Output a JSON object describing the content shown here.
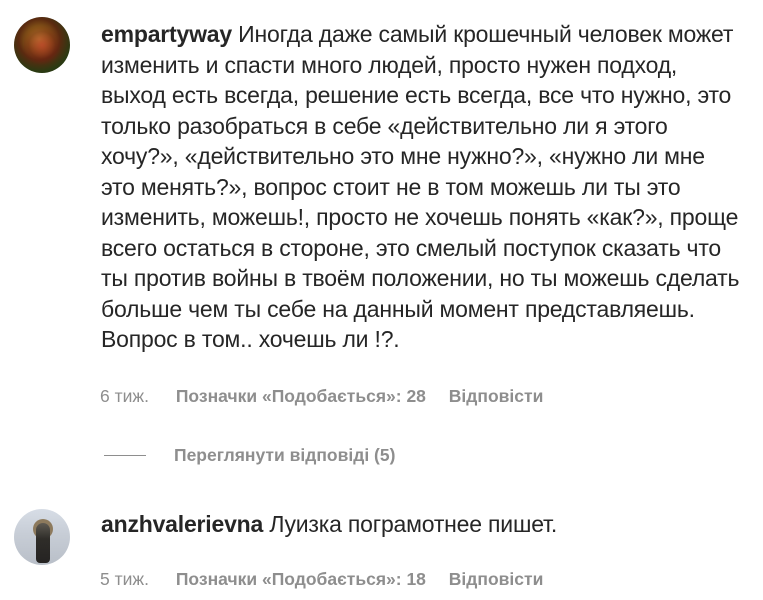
{
  "comments": [
    {
      "username": "empartyway",
      "text": "Иногда даже самый крошечный человек может изменить и спасти много людей, просто нужен подход, выход есть всегда, решение есть всегда, все что нужно, это только разобраться в себе «действительно ли я этого хочу?», «действительно это мне нужно?», «нужно ли мне это менять?», вопрос стоит не в том можешь ли ты это изменить, можешь!, просто не хочешь понять «как?», проще всего остаться в стороне, это смелый поступок сказать что ты против войны в твоём положении, но ты можешь сделать больше чем ты себе на данный момент представляешь. Вопрос в том.. хочешь ли !?.",
      "time": "6 тиж.",
      "likes": "Позначки «Подобається»: 28",
      "reply": "Відповісти",
      "view_replies": "Переглянути відповіді (5)"
    },
    {
      "username": "anzhvalerievna",
      "text": "Луизка пограмотнее пишет.",
      "time": "5 тиж.",
      "likes": "Позначки «Подобається»: 18",
      "reply": "Відповісти"
    }
  ]
}
